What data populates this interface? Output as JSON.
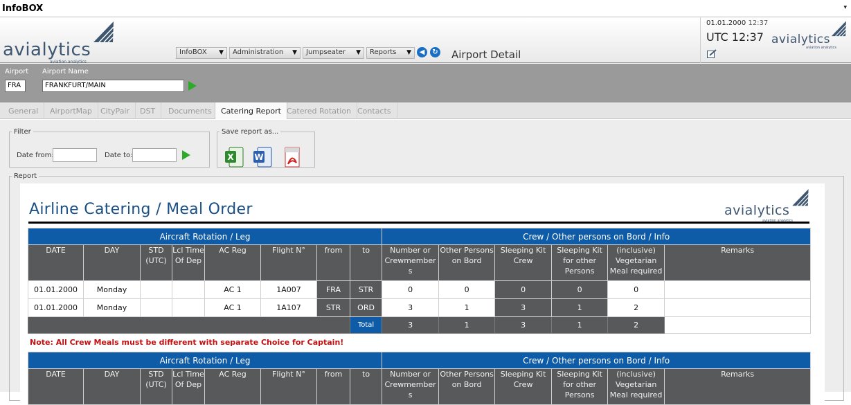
{
  "app": {
    "title": "InfoBOX"
  },
  "brand": {
    "name": "avialytics",
    "tagline": "aviation analytics"
  },
  "menu": [
    {
      "label": "InfoBOX"
    },
    {
      "label": "Administration"
    },
    {
      "label": "Jumpseater"
    },
    {
      "label": "Reports"
    }
  ],
  "page_title": "Airport Detail",
  "clock": {
    "date": "01.01.2000",
    "time": "12:37",
    "utc": "UTC 12:37"
  },
  "airport": {
    "code_label": "Airport",
    "code": "FRA",
    "name_label": "Airport Name",
    "name": "FRANKFURT/MAIN"
  },
  "tabs": [
    "General",
    "AirportMap",
    "CityPair",
    "DST",
    "Documents",
    "Catering Report",
    "Catered Rotation",
    "Contacts"
  ],
  "active_tab": "Catering Report",
  "filter": {
    "legend": "Filter",
    "date_from_label": "Date from:",
    "date_to_label": "Date to:",
    "date_from": "",
    "date_to": ""
  },
  "save": {
    "legend": "Save report as..."
  },
  "report": {
    "legend": "Report",
    "title": "Airline Catering / Meal Order",
    "section_left": "Aircraft Rotation / Leg",
    "section_right": "Crew / Other persons on Bord / Info",
    "columns": [
      "DATE",
      "DAY",
      "STD (UTC)",
      "Lcl Time Of Dep",
      "AC Reg",
      "Flight N°",
      "from",
      "to",
      "Number or Crewmember s",
      "Other Persons on Bord",
      "Sleeping Kit Crew",
      "Sleeping Kit for other Persons",
      "(inclusive) Vegetarian Meal required",
      "Remarks"
    ],
    "rows": [
      [
        "01.01.2000",
        "Monday",
        "",
        "",
        "AC 1",
        "1A007",
        "FRA",
        "STR",
        "0",
        "0",
        "0",
        "0",
        "0",
        ""
      ],
      [
        "01.01.2000",
        "Monday",
        "",
        "",
        "AC 1",
        "1A107",
        "STR",
        "ORD",
        "3",
        "1",
        "3",
        "1",
        "2",
        ""
      ]
    ],
    "total": {
      "label": "Total",
      "values": [
        "3",
        "1",
        "3",
        "1",
        "2"
      ]
    },
    "note": "Note: All Crew Meals must be different with separate Choice for Captain!"
  },
  "colors": {
    "section_blue": "#0e5ba8",
    "header_grey": "#58595b",
    "brand_blue": "#3f5671",
    "note_red": "#c01010"
  },
  "icons": [
    "excel-icon",
    "word-icon",
    "pdf-icon",
    "back-icon",
    "refresh-icon",
    "edit-icon",
    "go-arrow-icon"
  ]
}
